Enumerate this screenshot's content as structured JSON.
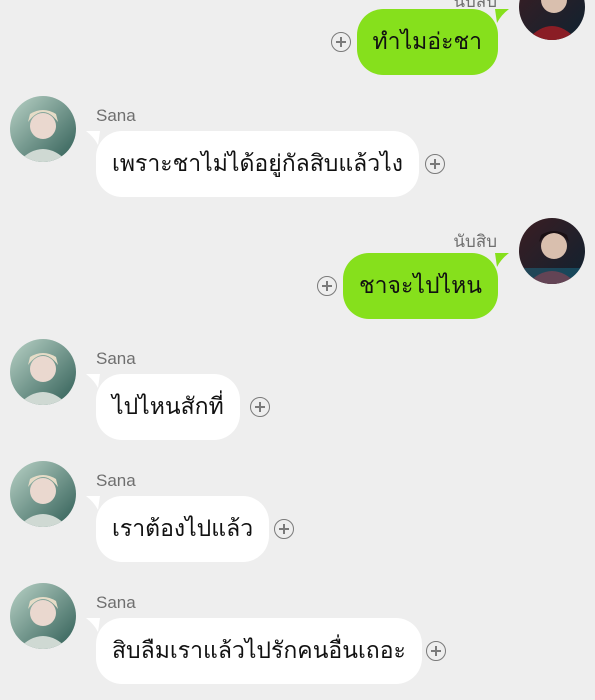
{
  "messages": [
    {
      "direction": "out",
      "sender": "นับสิบ",
      "text": "ทำไมอ่ะชา",
      "action_icon": "add-circle-icon"
    },
    {
      "direction": "in",
      "sender": "Sana",
      "text": "เพราะชาไม่ได้อยู่กัลสิบแล้วไง",
      "action_icon": "add-circle-icon"
    },
    {
      "direction": "out",
      "sender": "นับสิบ",
      "text": "ชาจะไปไหน",
      "action_icon": "add-circle-icon"
    },
    {
      "direction": "in",
      "sender": "Sana",
      "text": "ไปไหนสักที่",
      "action_icon": "add-circle-icon"
    },
    {
      "direction": "in",
      "sender": "Sana",
      "text": "เราต้องไปแล้ว",
      "action_icon": "add-circle-icon"
    },
    {
      "direction": "in",
      "sender": "Sana",
      "text": "สิบลืมเราแล้วไปรักคนอื่นเถอะ",
      "action_icon": "add-circle-icon"
    }
  ],
  "colors": {
    "background": "#eeeeee",
    "incoming_bubble": "#ffffff",
    "outgoing_bubble": "#86e01c",
    "sender_text": "#6f6f6f"
  }
}
